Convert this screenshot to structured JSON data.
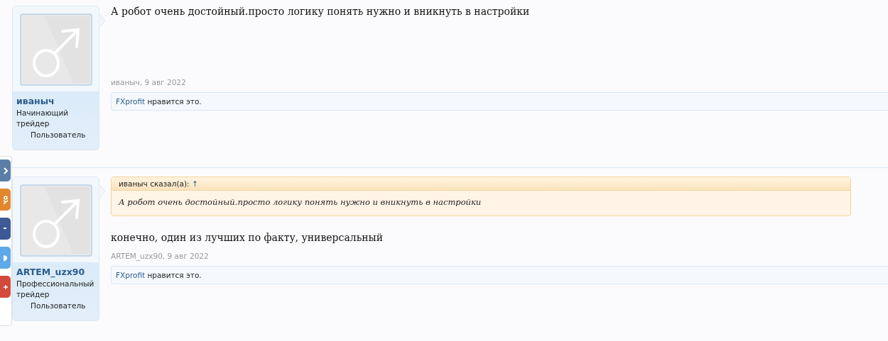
{
  "share_buttons": [
    {
      "kind": "vk"
    },
    {
      "kind": "ok"
    },
    {
      "kind": "facebook"
    },
    {
      "kind": "twitter"
    },
    {
      "kind": "gplus"
    }
  ],
  "posts": [
    {
      "user": {
        "name": "иваныч",
        "title": "Начинающий трейдер",
        "role": "Пользователь"
      },
      "message": "А робот очень достойный.просто логику понять нужно и вникнуть в настройки",
      "meta": "иваныч, 9 авг 2022",
      "likes": {
        "user": "FXprofit",
        "text": "нравится это."
      }
    },
    {
      "user": {
        "name": "ARTEM_uzx90",
        "title": "Профессиональный трейдер",
        "role": "Пользователь"
      },
      "quote": {
        "author": "иваныч сказал(а):",
        "link": "↑",
        "text": "А робот очень достойный.просто логику понять нужно и вникнуть в настройки"
      },
      "message": "конечно, один из лучших по факту, универсальный",
      "meta": "ARTEM_uzx90, 9 авг 2022",
      "likes": {
        "user": "FXprofit",
        "text": "нравится это."
      }
    }
  ]
}
